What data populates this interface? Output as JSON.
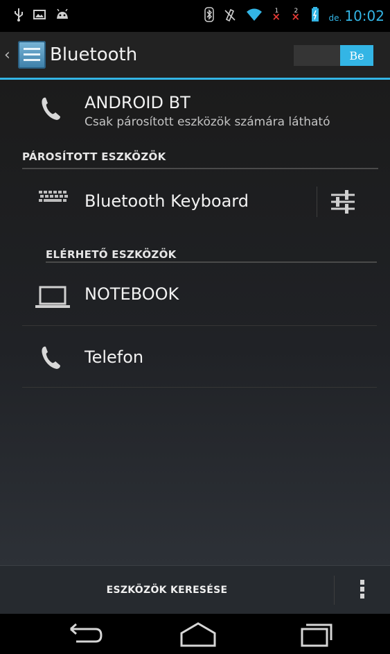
{
  "status_bar": {
    "icons": [
      "usb-icon",
      "image-icon",
      "android-icon",
      "bluetooth-icon",
      "vibrate-icon",
      "wifi-icon",
      "signal-1-x-icon",
      "signal-2-x-icon",
      "battery-icon"
    ],
    "sim1_label": "1",
    "sim2_label": "2",
    "ampm": "de.",
    "time": "10:02"
  },
  "action_bar": {
    "title": "Bluetooth",
    "toggle_label": "Be",
    "accent_color": "#33b5e5"
  },
  "own_device": {
    "name": "ANDROID BT",
    "visibility": "Csak párosított eszközök számára látható",
    "icon": "phone-icon"
  },
  "paired_section": {
    "header": "PÁROSÍTOTT ESZKÖZÖK",
    "devices": [
      {
        "name": "Bluetooth  Keyboard",
        "icon": "keyboard-icon",
        "settings_icon": "device-settings-icon"
      }
    ]
  },
  "available_section": {
    "header": "ELÉRHETŐ ESZKÖZÖK",
    "devices": [
      {
        "name": "NOTEBOOK",
        "icon": "laptop-icon"
      },
      {
        "name": "Telefon",
        "icon": "phone-icon"
      }
    ]
  },
  "bottom_bar": {
    "scan_label": "ESZKÖZÖK KERESÉSE",
    "overflow_icon": "overflow-menu-icon"
  },
  "nav_bar": {
    "icons": [
      "back-icon",
      "home-icon",
      "recent-apps-icon"
    ]
  }
}
